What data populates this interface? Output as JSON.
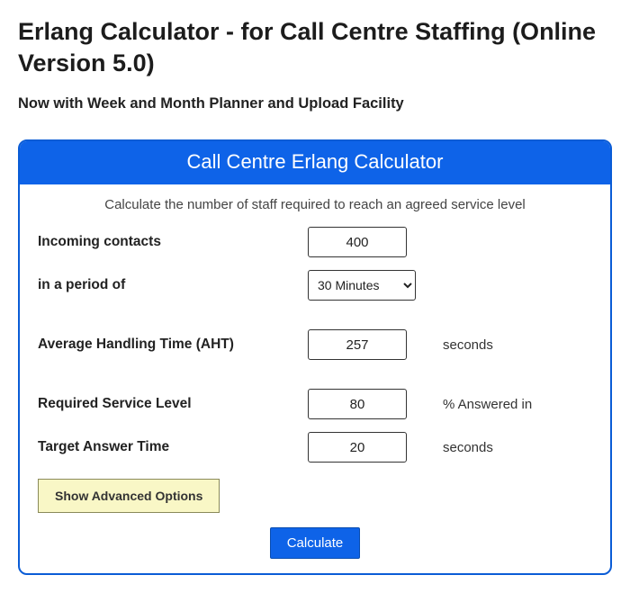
{
  "page": {
    "title": "Erlang Calculator - for Call Centre Staffing (Online Version 5.0)",
    "subtitle": "Now with Week and Month Planner and Upload Facility"
  },
  "card": {
    "header": "Call Centre Erlang Calculator",
    "instruction": "Calculate the number of staff required to reach an agreed service level"
  },
  "form": {
    "incoming_contacts": {
      "label": "Incoming contacts",
      "value": "400"
    },
    "period": {
      "label": "in a period of",
      "selected": "30 Minutes"
    },
    "aht": {
      "label": "Average Handling Time (AHT)",
      "value": "257",
      "unit": "seconds"
    },
    "service_level": {
      "label": "Required Service Level",
      "value": "80",
      "unit": "% Answered in"
    },
    "target_answer": {
      "label": "Target Answer Time",
      "value": "20",
      "unit": "seconds"
    }
  },
  "buttons": {
    "advanced": "Show Advanced Options",
    "calculate": "Calculate"
  }
}
